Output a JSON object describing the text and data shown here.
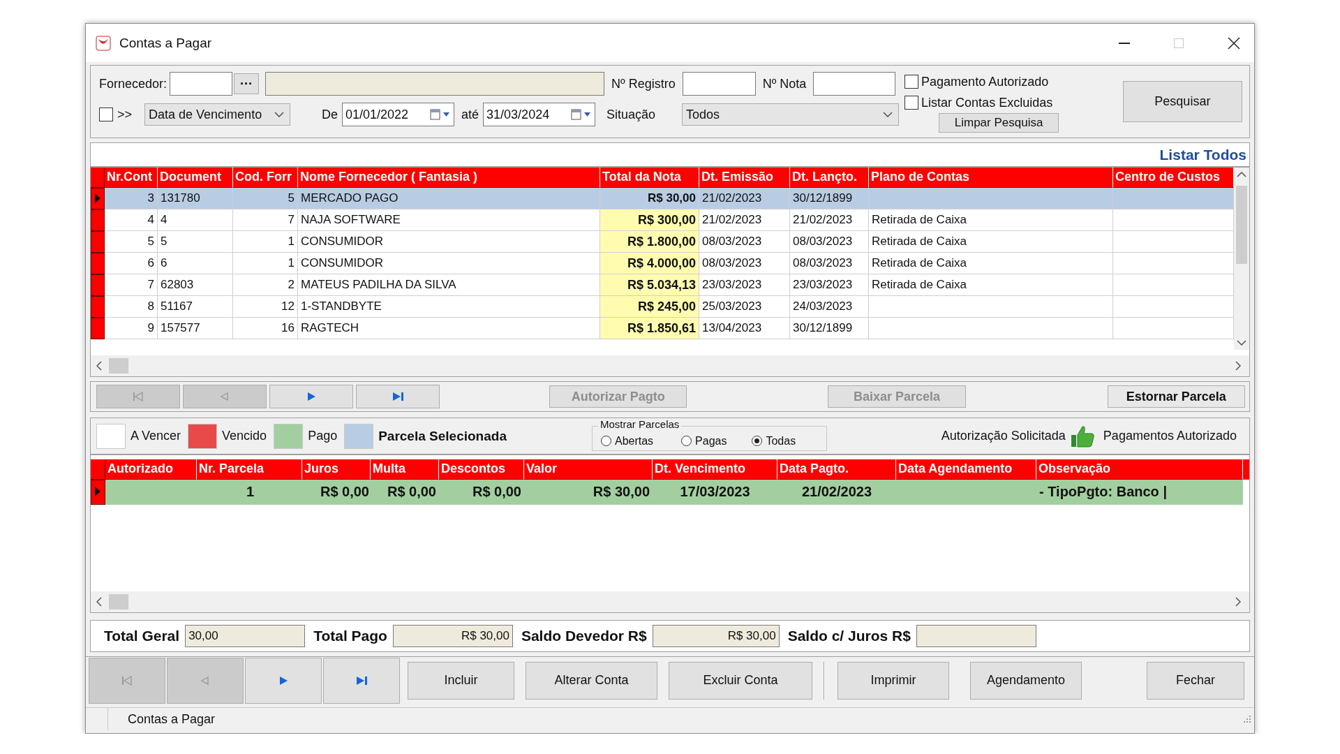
{
  "window": {
    "title": "Contas a Pagar"
  },
  "filters": {
    "fornecedor": {
      "label": "Fornecedor:",
      "browse_button": "···"
    },
    "registro": {
      "label": "Nº Registro"
    },
    "nota": {
      "label": "Nº Nota"
    },
    "range_check": {
      "label": ">>",
      "checked": false
    },
    "date_type": {
      "value": "Data de Vencimento"
    },
    "from": {
      "label": "De",
      "value": "01/01/2022"
    },
    "to": {
      "label": "até",
      "value": "31/03/2024"
    },
    "situacao": {
      "label": "Situação",
      "value": "Todos"
    },
    "checkboxes": [
      {
        "label": "Pagamento Autorizado",
        "checked": false
      },
      {
        "label": "Listar Contas Excluidas",
        "checked": false
      }
    ],
    "clear_button": "Limpar Pesquisa",
    "search_button": "Pesquisar"
  },
  "list_all_link": "Listar Todos",
  "accounts_table": {
    "columns": [
      "Nr.Cont",
      "Document",
      "Cod. Forr",
      "Nome Fornecedor ( Fantasia )",
      "Total da Nota",
      "Dt. Emissão",
      "Dt. Lançto.",
      "Plano de Contas",
      "Centro de Custos"
    ],
    "rows": [
      {
        "selected": true,
        "cells": [
          "3",
          "131780",
          "5",
          "MERCADO PAGO",
          "R$ 30,00",
          "21/02/2023",
          "30/12/1899",
          null,
          null
        ]
      },
      {
        "selected": false,
        "cells": [
          "4",
          "4",
          "7",
          "NAJA SOFTWARE",
          "R$ 300,00",
          "21/02/2023",
          "21/02/2023",
          "Retirada de Caixa",
          null
        ]
      },
      {
        "selected": false,
        "cells": [
          "5",
          "5",
          "1",
          "CONSUMIDOR",
          "R$ 1.800,00",
          "08/03/2023",
          "08/03/2023",
          "Retirada de Caixa",
          null
        ]
      },
      {
        "selected": false,
        "cells": [
          "6",
          "6",
          "1",
          "CONSUMIDOR",
          "R$ 4.000,00",
          "08/03/2023",
          "08/03/2023",
          "Retirada de Caixa",
          null
        ]
      },
      {
        "selected": false,
        "cells": [
          "7",
          "62803",
          "2",
          "MATEUS PADILHA DA SILVA",
          "R$ 5.034,13",
          "23/03/2023",
          "23/03/2023",
          "Retirada de Caixa",
          null
        ]
      },
      {
        "selected": false,
        "cells": [
          "8",
          "51167",
          "12",
          "1-STANDBYTE",
          "R$ 245,00",
          "25/03/2023",
          "24/03/2023",
          null,
          null
        ]
      },
      {
        "selected": false,
        "cells": [
          "9",
          "157577",
          "16",
          "RAGTECH",
          "R$ 1.850,61",
          "13/04/2023",
          "30/12/1899",
          null,
          null
        ]
      }
    ]
  },
  "record_nav": [
    {
      "kind": "first",
      "disabled": true
    },
    {
      "kind": "prior",
      "disabled": true
    },
    {
      "kind": "next",
      "disabled": false
    },
    {
      "kind": "last",
      "disabled": false
    }
  ],
  "installment_actions": [
    {
      "label": "Autorizar Pagto",
      "disabled": true
    },
    {
      "label": "Baixar Parcela",
      "disabled": true
    },
    {
      "label": "Estornar Parcela",
      "disabled": false
    }
  ],
  "legend": [
    {
      "label": "A Vencer",
      "color": "#ffffff",
      "bold": false
    },
    {
      "label": "Vencido",
      "color": "#e84a4a",
      "bold": false
    },
    {
      "label": "Pago",
      "color": "#a3cfa0",
      "bold": false
    },
    {
      "label": "Parcela Selecionada",
      "color": "#b8cce4",
      "bold": true
    }
  ],
  "show_parcels": {
    "title": "Mostrar Parcelas",
    "options": [
      {
        "label": "Abertas",
        "selected": false
      },
      {
        "label": "Pagas",
        "selected": false
      },
      {
        "label": "Todas",
        "selected": true
      }
    ]
  },
  "authorization": {
    "requested_label": "Autorização Solicitada",
    "approved_label": "Pagamentos Autorizado"
  },
  "installments_table": {
    "columns": [
      "Autorizado",
      "Nr. Parcela",
      "Juros",
      "Multa",
      "Descontos",
      "Valor",
      "Dt. Vencimento",
      "Data Pagto.",
      "Data Agendamento",
      "Observação"
    ],
    "rows": [
      {
        "selected": true,
        "cells": [
          null,
          "1",
          "R$ 0,00",
          "R$ 0,00",
          "R$ 0,00",
          "R$ 30,00",
          "17/03/2023",
          "21/02/2023",
          null,
          "- TipoPgto: Banco |"
        ]
      }
    ]
  },
  "totals": [
    {
      "label": "Total Geral",
      "value": "30,00"
    },
    {
      "label": "Total Pago",
      "value": "R$ 30,00"
    },
    {
      "label": "Saldo Devedor R$",
      "value": "R$ 30,00"
    },
    {
      "label": "Saldo c/ Juros R$"
    }
  ],
  "bottom_nav": [
    {
      "kind": "first",
      "disabled": true
    },
    {
      "kind": "prior",
      "disabled": true
    },
    {
      "kind": "next",
      "disabled": false
    },
    {
      "kind": "last",
      "disabled": false
    }
  ],
  "bottom_buttons": [
    [
      "Incluir",
      "Alterar Conta",
      "Excluir Conta"
    ],
    [
      "Imprimir",
      "Agendamento"
    ],
    [
      "Fechar"
    ]
  ],
  "status_bar": {
    "text": "Contas a Pagar"
  }
}
